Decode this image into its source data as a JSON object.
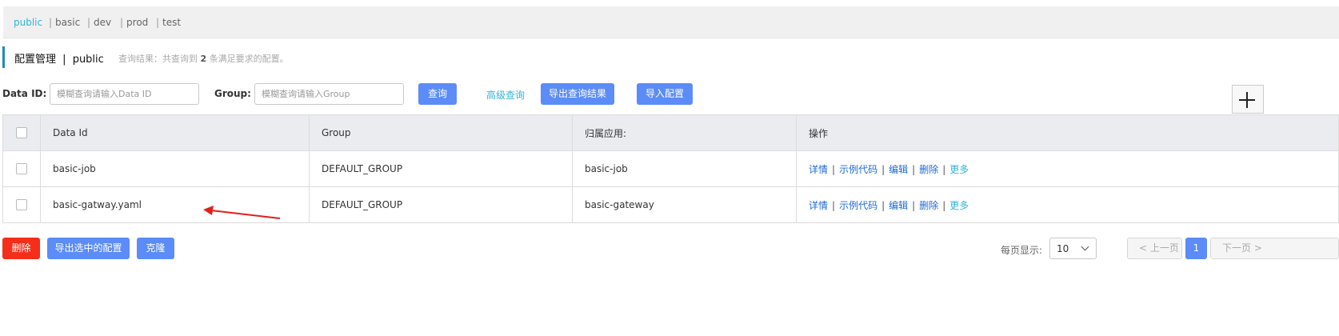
{
  "namespaces": [
    {
      "label": "public",
      "active": true
    },
    {
      "label": "basic",
      "active": false
    },
    {
      "label": "dev",
      "active": false
    },
    {
      "label": "prod",
      "active": false
    },
    {
      "label": "test",
      "active": false
    }
  ],
  "namespace_separator": "|",
  "header": {
    "title": "配置管理",
    "separator": "|",
    "namespace": "public",
    "result_prefix": "查询结果：共查询到",
    "result_count": "2",
    "result_suffix": "条满足要求的配置。"
  },
  "search": {
    "data_id_label": "Data ID:",
    "data_id_placeholder": "模糊查询请输入Data ID",
    "group_label": "Group:",
    "group_placeholder": "模糊查询请输入Group",
    "query_button": "查询",
    "advanced_link": "高级查询",
    "export_button": "导出查询结果",
    "import_button": "导入配置"
  },
  "table": {
    "columns": [
      "Data Id",
      "Group",
      "归属应用:",
      "操作"
    ],
    "rows": [
      {
        "data_id": "basic-job",
        "group": "DEFAULT_GROUP",
        "app": "basic-job"
      },
      {
        "data_id": "basic-gatway.yaml",
        "group": "DEFAULT_GROUP",
        "app": "basic-gateway"
      }
    ],
    "actions": {
      "detail": "详情",
      "sample": "示例代码",
      "edit": "编辑",
      "delete": "删除",
      "more": "更多",
      "separator": "|"
    }
  },
  "footer": {
    "delete_button": "删除",
    "export_selected_button": "导出选中的配置",
    "clone_button": "克隆",
    "page_size_label": "每页显示:",
    "page_size_value": "10",
    "prev_button": "< 上一页",
    "current_page": "1",
    "next_button": "下一页 >"
  },
  "colors": {
    "primary": "#5b8cf7",
    "danger": "#f52e1a",
    "link": "#1f6ad6",
    "accent": "#33b5d8",
    "annotation_arrow": "#e0201c"
  }
}
